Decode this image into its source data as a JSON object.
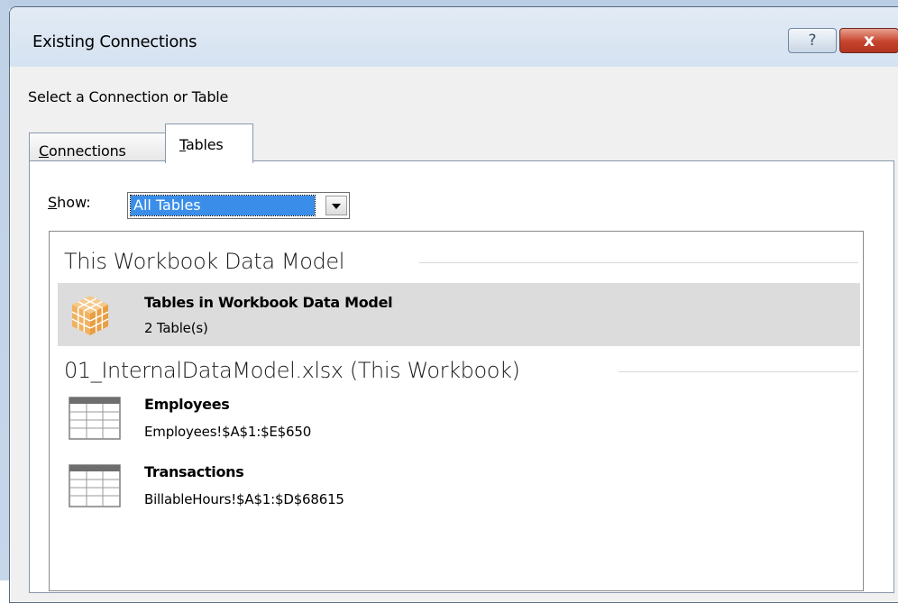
{
  "dialog": {
    "title": "Existing Connections",
    "help_glyph": "?",
    "close_glyph": "x",
    "prompt": "Select a Connection or Table"
  },
  "tabs": [
    {
      "label": "Connections",
      "accesskey": "C",
      "rest": "onnections",
      "active": false
    },
    {
      "label": "Tables",
      "accesskey": "T",
      "rest": "ables",
      "active": true
    }
  ],
  "filter": {
    "label": "Show:",
    "label_access": "S",
    "label_rest": "how:",
    "selected": "All Tables"
  },
  "groups": [
    {
      "header": "This Workbook Data Model",
      "items": [
        {
          "title": "Tables in Workbook Data Model",
          "subtitle": "2 Table(s)",
          "icon": "data-model-cube-icon",
          "selected": true
        }
      ]
    },
    {
      "header": "01_InternalDataModel.xlsx (This Workbook)",
      "items": [
        {
          "title": "Employees",
          "subtitle": "Employees!$A$1:$E$650",
          "icon": "table-icon",
          "selected": false
        },
        {
          "title": "Transactions",
          "subtitle": "BillableHours!$A$1:$D$68615",
          "icon": "table-icon",
          "selected": false
        }
      ]
    }
  ],
  "colors": {
    "selection_blue": "#3a8ee9",
    "selected_row": "#dcdcdc",
    "close_red": "#c6432d"
  }
}
